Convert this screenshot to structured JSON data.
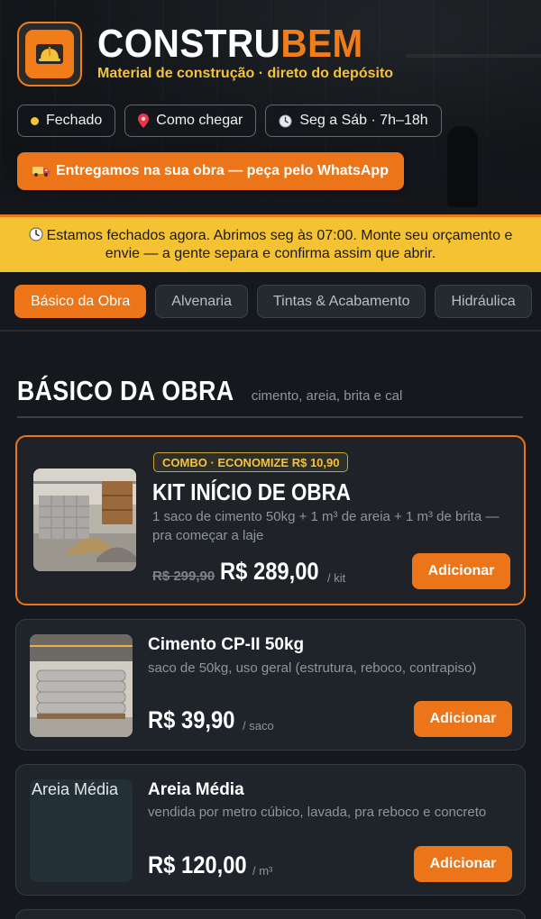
{
  "brand": {
    "name_part1": "CONSTRU",
    "name_part2": "BEM",
    "tagline": "Material de construção · direto do depósito",
    "accent": "#ec7419",
    "highlight": "#f5c23a"
  },
  "header_chips": {
    "status": "Fechado",
    "directions": "Como chegar",
    "hours": "Seg a Sáb · 7h–18h"
  },
  "cta": {
    "whatsapp": "Entregamos na sua obra — peça pelo WhatsApp"
  },
  "banner": {
    "text": "Estamos fechados agora. Abrimos seg às 07:00. Monte seu orçamento e envie — a gente separa e confirma assim que abrir."
  },
  "tabs": [
    {
      "label": "Básico da Obra",
      "active": true
    },
    {
      "label": "Alvenaria",
      "active": false
    },
    {
      "label": "Tintas & Acabamento",
      "active": false
    },
    {
      "label": "Hidráulica",
      "active": false
    }
  ],
  "section": {
    "title": "BÁSICO DA OBRA",
    "subtitle": "cimento, areia, brita e cal"
  },
  "products": [
    {
      "badge": "COMBO · ECONOMIZE R$ 10,90",
      "title": "KIT INÍCIO DE OBRA",
      "description": "1 saco de cimento 50kg + 1 m³ de areia + 1 m³ de brita — pra começar a laje",
      "old_price": "R$ 299,90",
      "price": "R$ 289,00",
      "unit": "/ kit",
      "button": "Adicionar"
    },
    {
      "title": "Cimento CP-II 50kg",
      "description": "saco de 50kg, uso geral (estrutura, reboco, contrapiso)",
      "price": "R$ 39,90",
      "unit": "/ saco",
      "button": "Adicionar"
    },
    {
      "title": "Areia Média",
      "image_alt": "Areia Média",
      "description": "vendida por metro cúbico, lavada, pra reboco e concreto",
      "price": "R$ 120,00",
      "unit": "/ m³",
      "button": "Adicionar"
    }
  ]
}
